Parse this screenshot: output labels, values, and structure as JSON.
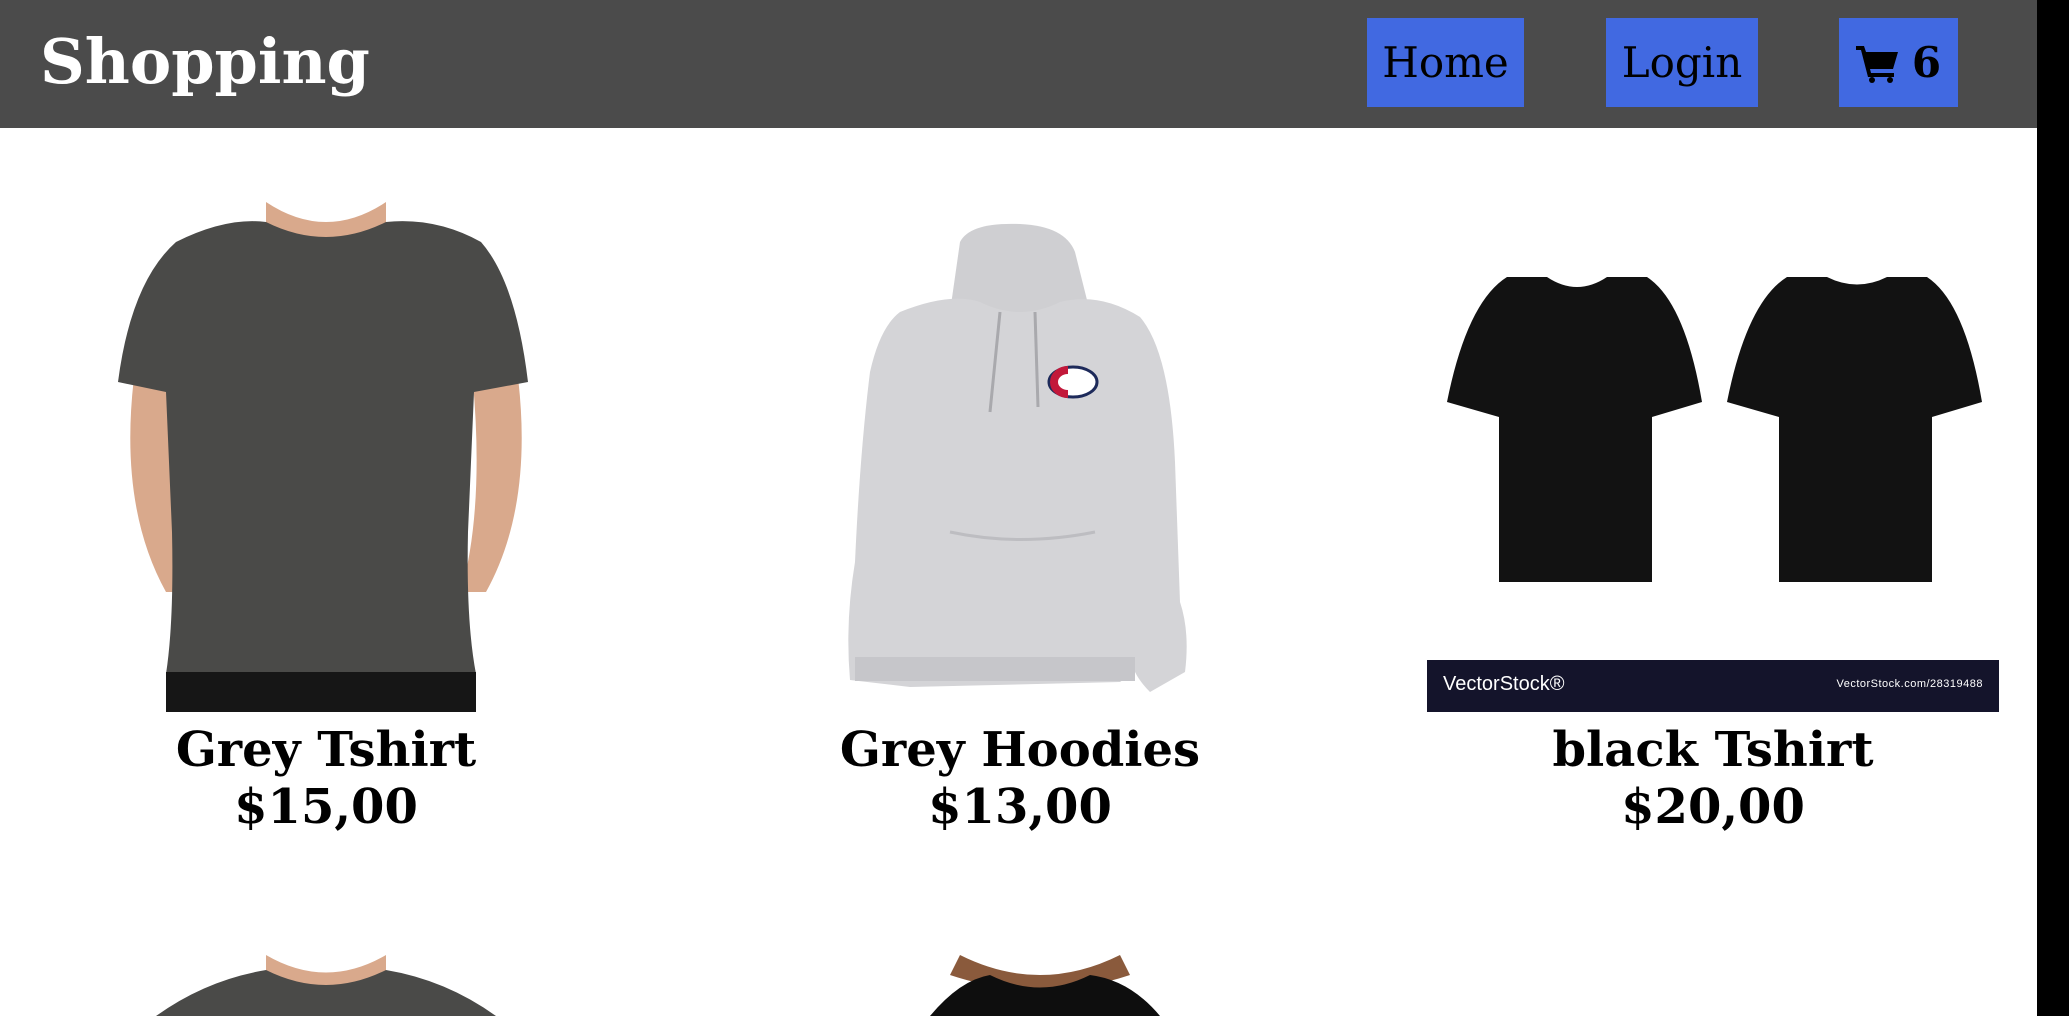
{
  "header": {
    "title": "Shopping",
    "nav": {
      "home_label": "Home",
      "login_label": "Login",
      "cart_count": "6"
    }
  },
  "products": [
    {
      "name": "Grey Tshirt",
      "price": "$15,00",
      "image": "grey-tshirt-photo"
    },
    {
      "name": "Grey Hoodies",
      "price": "$13,00",
      "image": "grey-hoodie-photo",
      "logo_text": "C"
    },
    {
      "name": "black Tshirt",
      "price": "$20,00",
      "image": "black-tshirt-front-back-photo",
      "watermark": {
        "left": "VectorStock®",
        "right": "VectorStock.com/28319488"
      }
    }
  ],
  "colors": {
    "header_bg": "#4b4b4b",
    "nav_button_bg": "#4169e1",
    "page_bg": "#ffffff"
  }
}
